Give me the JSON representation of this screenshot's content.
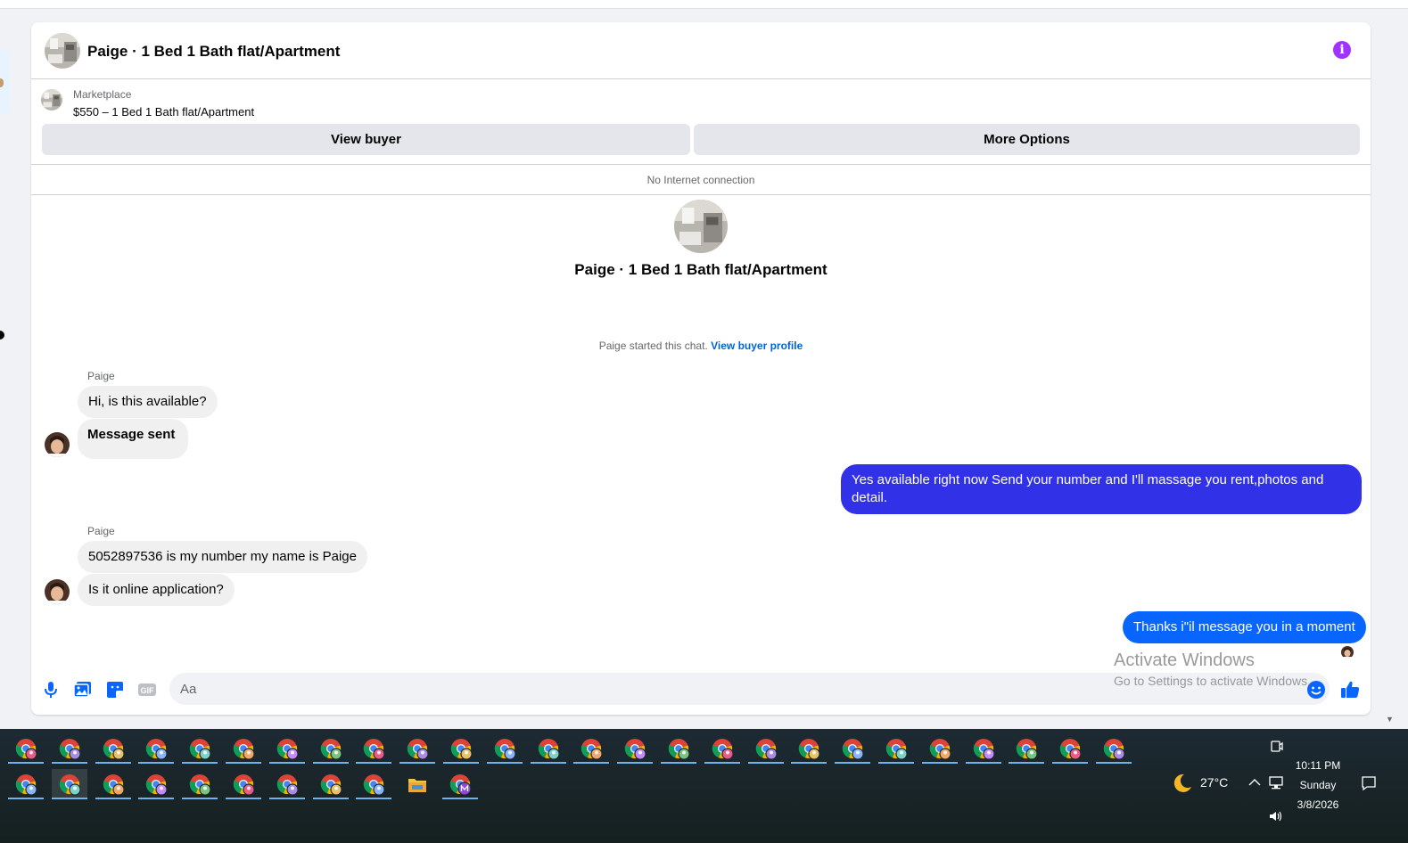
{
  "chat": {
    "title": "Paige · 1 Bed 1 Bath flat/Apartment",
    "listing": {
      "source": "Marketplace",
      "title": "$550 – 1 Bed 1 Bath flat/Apartment"
    },
    "actions": {
      "view_buyer": "View buyer",
      "more_options": "More Options"
    },
    "connection_status": "No Internet connection",
    "intro": {
      "title": "Paige · 1 Bed 1 Bath flat/Apartment",
      "started_text": "Paige started this chat.",
      "profile_link": "View buyer profile"
    },
    "messages": [
      {
        "sender": "Paige",
        "text": "Hi, is this available?"
      },
      {
        "text": "Message sent"
      },
      {
        "text": "Yes available right now Send your number and I'll massage you rent,photos and detail."
      },
      {
        "sender": "Paige",
        "text": "5052897536 is my number my name is Paige"
      },
      {
        "text": "Is it online application?"
      },
      {
        "text": "Thanks i\"il message you in a moment"
      }
    ],
    "composer": {
      "placeholder": "Aa"
    }
  },
  "watermark": {
    "title": "Activate Windows",
    "subtitle": "Go to Settings to activate Windows."
  },
  "taskbar": {
    "weather": "27°C",
    "time": "10:11 PM",
    "day": "Sunday",
    "date": "3/8/2026"
  },
  "colors": {
    "outgoing_bubble": "#3131e8",
    "outgoing_bubble_alt": "#0866ff",
    "incoming_bubble": "#f0f0f0",
    "messenger_blue": "#0866ff",
    "info_purple": "#a033ff",
    "link_blue": "#0064d1"
  },
  "icons": [
    "info-icon",
    "microphone-icon",
    "photo-icon",
    "sticker-icon",
    "gif-icon",
    "emoji-icon",
    "thumbs-up-icon",
    "chrome-icon",
    "folder-icon",
    "moon-icon",
    "chevron-up-icon",
    "network-icon",
    "speaker-icon",
    "notification-icon",
    "meet-now-icon"
  ]
}
